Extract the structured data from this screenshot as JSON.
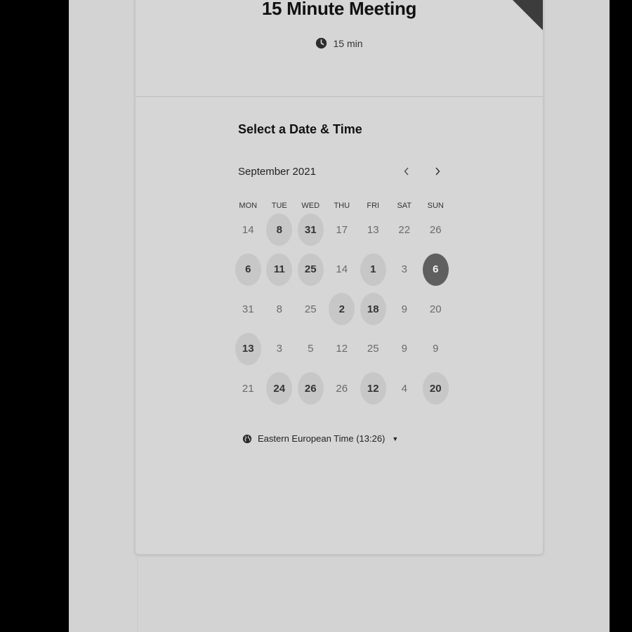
{
  "event": {
    "title": "15 Minute Meeting",
    "duration": "15 min"
  },
  "scheduler": {
    "section_title": "Select a Date & Time",
    "month": "September 2021",
    "prev_icon": "chevron-left-icon",
    "next_icon": "chevron-right-icon",
    "weekdays": [
      "MON",
      "TUE",
      "WED",
      "THU",
      "FRI",
      "SAT",
      "SUN"
    ],
    "weeks": [
      [
        {
          "label": "14",
          "state": "unavailable"
        },
        {
          "label": "8",
          "state": "available"
        },
        {
          "label": "31",
          "state": "available"
        },
        {
          "label": "17",
          "state": "unavailable"
        },
        {
          "label": "13",
          "state": "unavailable"
        },
        {
          "label": "22",
          "state": "unavailable"
        },
        {
          "label": "26",
          "state": "unavailable"
        }
      ],
      [
        {
          "label": "6",
          "state": "available"
        },
        {
          "label": "11",
          "state": "available"
        },
        {
          "label": "25",
          "state": "available"
        },
        {
          "label": "14",
          "state": "unavailable"
        },
        {
          "label": "1",
          "state": "available"
        },
        {
          "label": "3",
          "state": "unavailable"
        },
        {
          "label": "6",
          "state": "selected"
        }
      ],
      [
        {
          "label": "31",
          "state": "unavailable"
        },
        {
          "label": "8",
          "state": "unavailable"
        },
        {
          "label": "25",
          "state": "unavailable"
        },
        {
          "label": "2",
          "state": "available"
        },
        {
          "label": "18",
          "state": "available"
        },
        {
          "label": "9",
          "state": "unavailable"
        },
        {
          "label": "20",
          "state": "unavailable"
        }
      ],
      [
        {
          "label": "13",
          "state": "available"
        },
        {
          "label": "3",
          "state": "unavailable"
        },
        {
          "label": "5",
          "state": "unavailable"
        },
        {
          "label": "12",
          "state": "unavailable"
        },
        {
          "label": "25",
          "state": "unavailable"
        },
        {
          "label": "9",
          "state": "unavailable"
        },
        {
          "label": "9",
          "state": "unavailable"
        }
      ],
      [
        {
          "label": "21",
          "state": "unavailable"
        },
        {
          "label": "24",
          "state": "available"
        },
        {
          "label": "26",
          "state": "available"
        },
        {
          "label": "26",
          "state": "unavailable"
        },
        {
          "label": "12",
          "state": "available"
        },
        {
          "label": "4",
          "state": "unavailable"
        },
        {
          "label": "20",
          "state": "available"
        }
      ]
    ],
    "timezone": "Eastern European Time (13:26)",
    "timezone_icon": "globe-icon"
  },
  "colors": {
    "page_bg": "#d3d3d3",
    "card_bg": "#d6d6d6",
    "available_bg": "#c7c7c7",
    "selected_bg": "#5f5f5f",
    "ribbon": "#3c3c3c"
  }
}
